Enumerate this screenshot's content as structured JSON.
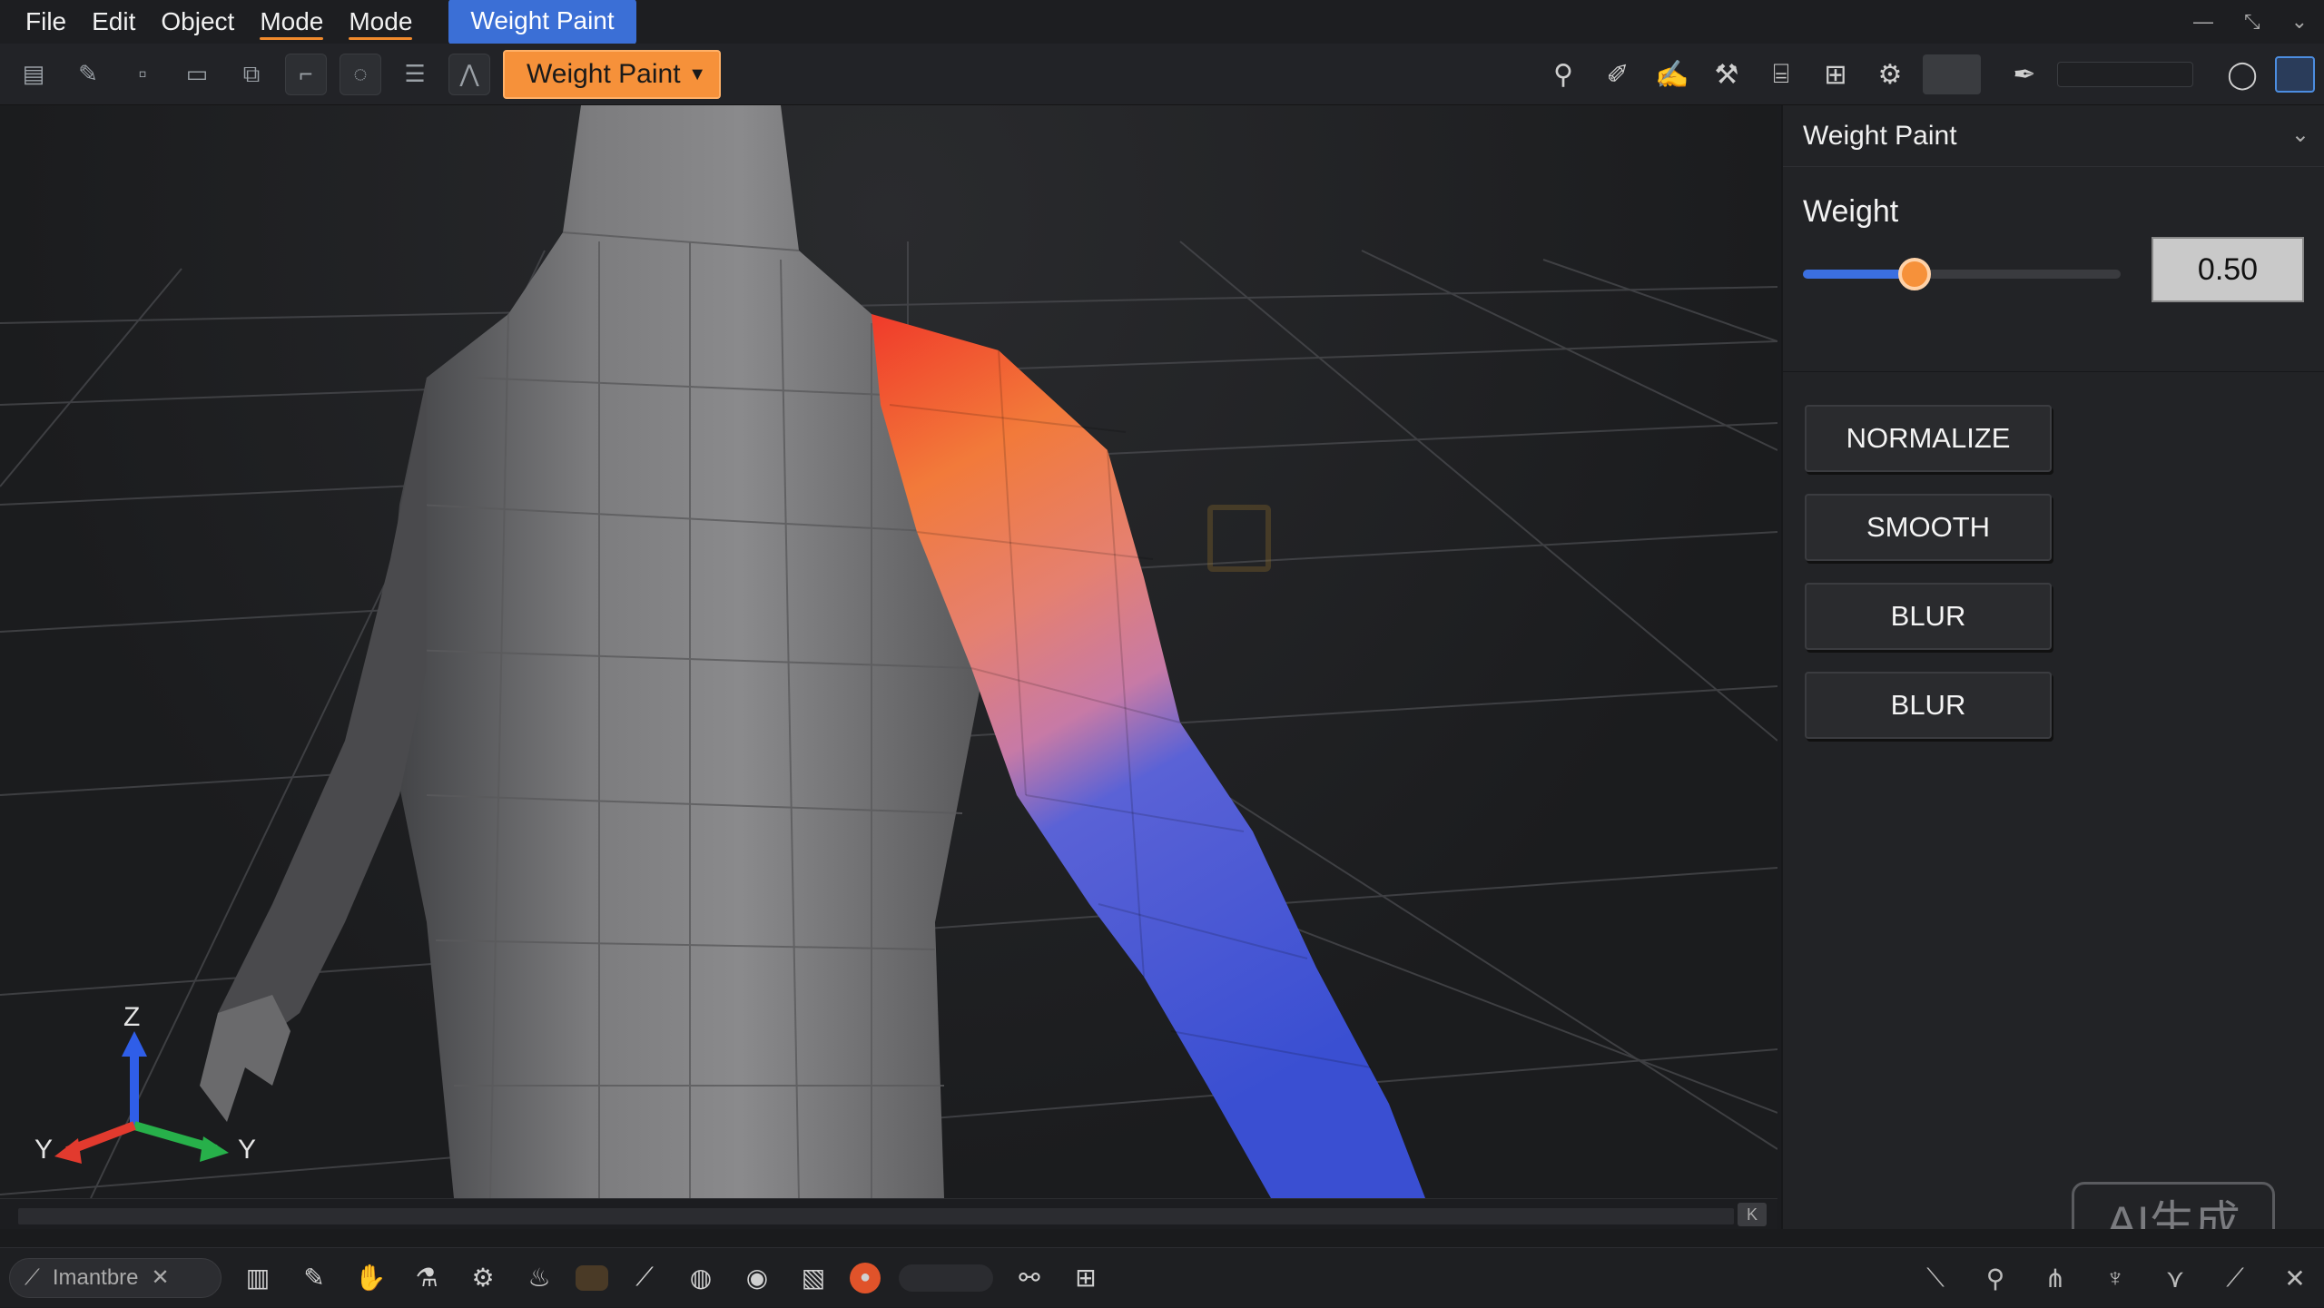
{
  "menu": {
    "items": [
      "File",
      "Edit",
      "Object",
      "Mode",
      "Mode"
    ],
    "active": "Weight Paint"
  },
  "toolbar": {
    "mode_select": "Weight Paint"
  },
  "viewport": {
    "axes": {
      "z": "Z",
      "y_left": "Y",
      "y_right": "Y"
    }
  },
  "panel": {
    "title": "Weight Paint",
    "weight_label": "Weight",
    "weight_value": "0.50",
    "weight_fraction": 0.35,
    "buttons": [
      "NORMALIZE",
      "SMOOTH",
      "BLUR",
      "BLUR"
    ]
  },
  "badge": "AI生成",
  "bottombar": {
    "search_text": "Imantbre"
  },
  "colors": {
    "accent_orange": "#f6913a",
    "accent_blue": "#3b6fd6",
    "weight_high": "#f03a2a",
    "weight_low": "#3b58d8"
  }
}
